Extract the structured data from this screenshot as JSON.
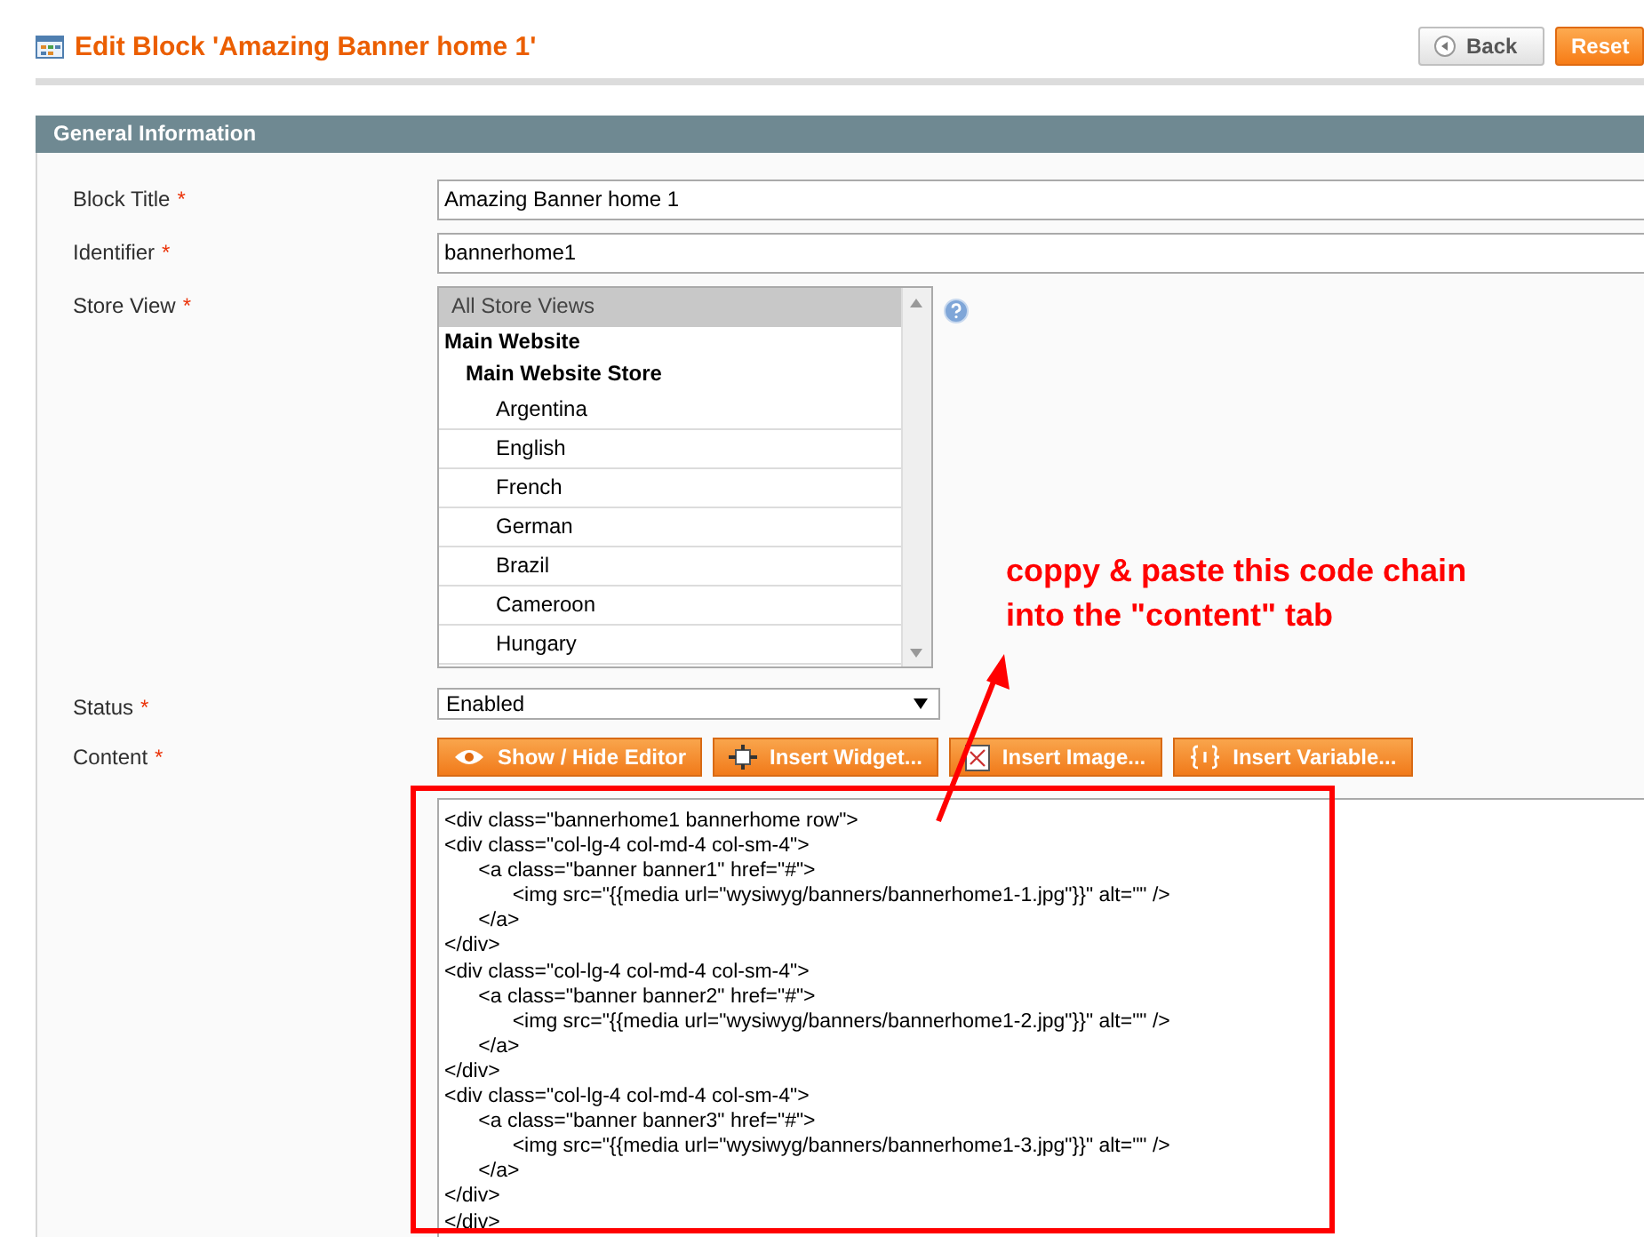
{
  "header": {
    "title": "Edit Block 'Amazing Banner home 1'",
    "buttons": [
      {
        "label": "Back",
        "kind": "back"
      },
      {
        "label": "Reset",
        "kind": "reset"
      }
    ]
  },
  "section": {
    "title": "General Information"
  },
  "fields": [
    {
      "kind": "text",
      "label": "Block Title",
      "required_mark": "*",
      "value": "Amazing Banner home 1"
    },
    {
      "kind": "text",
      "label": "Identifier",
      "required_mark": "*",
      "value": "bannerhome1"
    },
    {
      "kind": "multiselect",
      "label": "Store View",
      "required_mark": "*",
      "options": [
        {
          "label": "All Store Views",
          "selected": true
        },
        {
          "label": "Main Website",
          "children": [
            {
              "label": "Main Website Store",
              "children": [
                {
                  "label": "Argentina",
                  "selected": false
                },
                {
                  "label": "English",
                  "selected": false
                },
                {
                  "label": "French",
                  "selected": false
                },
                {
                  "label": "German",
                  "selected": false
                },
                {
                  "label": "Brazil",
                  "selected": false
                },
                {
                  "label": "Cameroon",
                  "selected": false
                },
                {
                  "label": "Hungary",
                  "selected": false
                }
              ]
            }
          ]
        }
      ]
    },
    {
      "kind": "select",
      "label": "Status",
      "required_mark": "*",
      "value": "Enabled"
    },
    {
      "kind": "editor",
      "label": "Content",
      "required_mark": "*",
      "buttons": [
        {
          "label": "Show / Hide Editor",
          "kind": "eye"
        },
        {
          "label": "Insert Widget...",
          "kind": "widget"
        },
        {
          "label": "Insert Image...",
          "kind": "image"
        },
        {
          "label": "Insert Variable...",
          "kind": "variable"
        }
      ],
      "lines": [
        "<div class=\"bannerhome1 bannerhome row\">",
        "<div class=\"col-lg-4 col-md-4 col-sm-4\">",
        "\t<a class=\"banner banner1\" href=\"#\">",
        "\t\t<img src=\"{{media url=\"wysiwyg/banners/bannerhome1-1.jpg\"}}\" alt=\"\" />",
        "\t</a>",
        "</div>",
        "<div class=\"col-lg-4 col-md-4 col-sm-4\">",
        "\t<a class=\"banner banner2\" href=\"#\">",
        "\t\t<img src=\"{{media url=\"wysiwyg/banners/bannerhome1-2.jpg\"}}\" alt=\"\" />",
        "\t</a>",
        "</div>",
        "<div class=\"col-lg-4 col-md-4 col-sm-4\">",
        "\t<a class=\"banner banner3\" href=\"#\">",
        "\t\t<img src=\"{{media url=\"wysiwyg/banners/bannerhome1-3.jpg\"}}\" alt=\"\" />",
        "\t</a>",
        "</div>",
        "</div>"
      ]
    }
  ],
  "annotation": {
    "lines": [
      "coppy & paste this code chain",
      "into the \"content\" tab"
    ]
  }
}
